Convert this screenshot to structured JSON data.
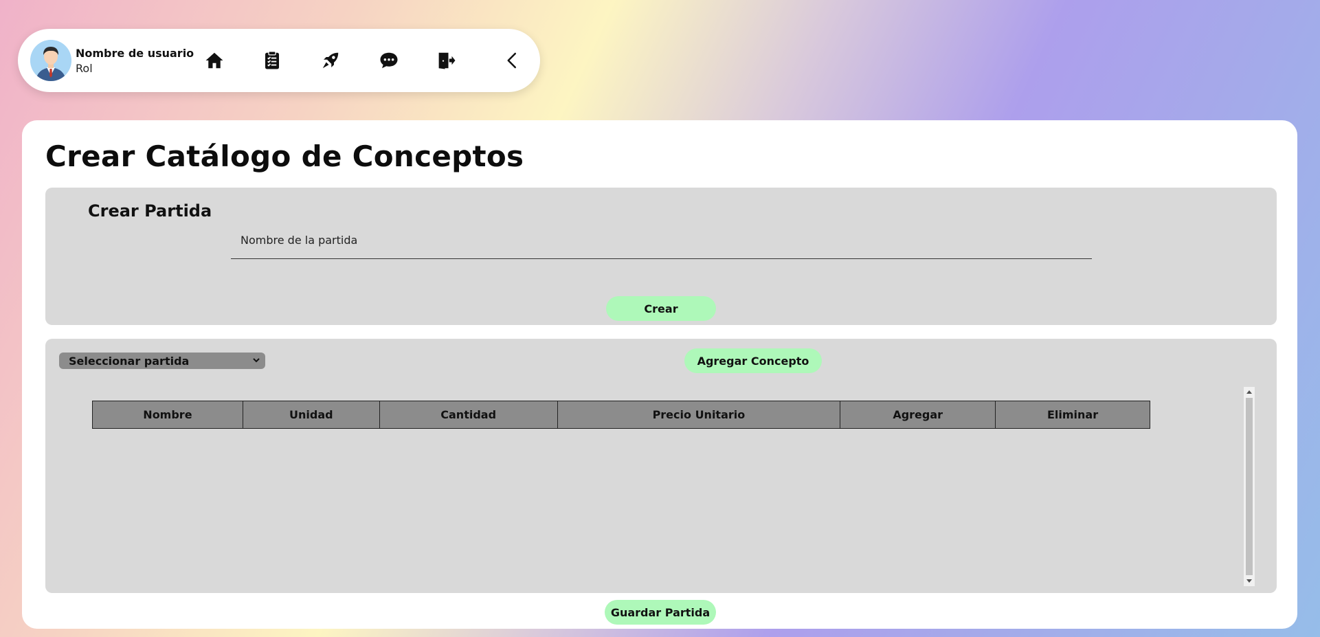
{
  "user": {
    "name": "Nombre de usuario",
    "role": "Rol"
  },
  "nav": {
    "icons": [
      "home-icon",
      "clipboard-list-icon",
      "rocket-icon",
      "chat-icon",
      "logout-icon",
      "chevron-left-icon"
    ]
  },
  "page": {
    "title": "Crear Catálogo de Conceptos"
  },
  "create_section": {
    "title": "Crear Partida",
    "input_placeholder": "Nombre de la partida",
    "create_button": "Crear"
  },
  "concepts_section": {
    "select_label": "Seleccionar partida",
    "add_concept_button": "Agregar Concepto",
    "columns": [
      "Nombre",
      "Unidad",
      "Cantidad",
      "Precio Unitario",
      "Agregar",
      "Eliminar"
    ]
  },
  "footer": {
    "save_button": "Guardar Partida"
  },
  "colors": {
    "green_button": "#aef8b9",
    "panel_gray": "#d9d9d9",
    "header_gray": "#8c8c8c"
  }
}
